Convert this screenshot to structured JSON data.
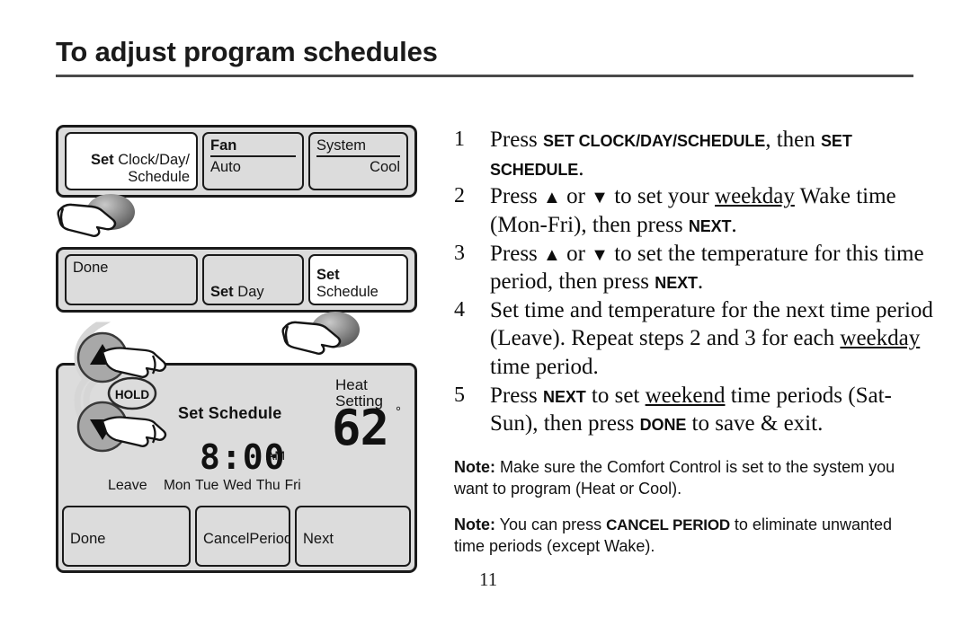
{
  "page": {
    "title": "To adjust program schedules",
    "number": "11"
  },
  "thermostat": {
    "panel1": {
      "buttons": [
        {
          "name": "set-clock-day-schedule",
          "bold_prefix": "Set",
          "line1": " Clock/Day/",
          "line2": "Schedule",
          "highlighted": true
        },
        {
          "name": "fan",
          "header": "Fan",
          "value": "Auto"
        },
        {
          "name": "system",
          "header": "System",
          "value": "Cool"
        }
      ]
    },
    "panel2": {
      "buttons": [
        {
          "name": "done",
          "label": "Done"
        },
        {
          "name": "set-day",
          "bold_prefix": "Set",
          "rest": " Day"
        },
        {
          "name": "set-schedule",
          "bold_prefix": "Set",
          "rest": " Schedule",
          "highlighted": true
        }
      ]
    },
    "display": {
      "mode_label": "Set Schedule",
      "time": "8:00",
      "meridiem": "AM",
      "period_label": "Leave",
      "days": [
        "Mon",
        "Tue",
        "Wed",
        "Thu",
        "Fri"
      ],
      "setting_label_line1": "Heat",
      "setting_label_line2": "Setting",
      "temperature": "62",
      "degree": "°",
      "hold_label": "HOLD"
    },
    "panel3_buttons": [
      {
        "name": "done",
        "label": "Done"
      },
      {
        "name": "cancel-period",
        "label": "CancelPeriod"
      },
      {
        "name": "next",
        "label": "Next"
      }
    ]
  },
  "instructions": {
    "steps": [
      {
        "num": "1",
        "parts": [
          {
            "t": "text",
            "v": "Press "
          },
          {
            "t": "kbd",
            "v": "Set Clock/Day/Schedule"
          },
          {
            "t": "text",
            "v": ", then "
          },
          {
            "t": "kbd",
            "v": "Set Schedule"
          },
          {
            "t": "text",
            "v": "."
          }
        ]
      },
      {
        "num": "2",
        "parts": [
          {
            "t": "text",
            "v": "Press "
          },
          {
            "t": "up",
            "v": "▲"
          },
          {
            "t": "text",
            "v": " or "
          },
          {
            "t": "down",
            "v": "▼"
          },
          {
            "t": "text",
            "v": " to set your "
          },
          {
            "t": "uline",
            "v": "weekday"
          },
          {
            "t": "text",
            "v": " Wake time (Mon-Fri), then press "
          },
          {
            "t": "kbd",
            "v": "Next"
          },
          {
            "t": "text",
            "v": "."
          }
        ]
      },
      {
        "num": "3",
        "parts": [
          {
            "t": "text",
            "v": "Press "
          },
          {
            "t": "up",
            "v": "▲"
          },
          {
            "t": "text",
            "v": " or "
          },
          {
            "t": "down",
            "v": "▼"
          },
          {
            "t": "text",
            "v": " to set the temperature for this time period, then press "
          },
          {
            "t": "kbd",
            "v": "Next"
          },
          {
            "t": "text",
            "v": "."
          }
        ]
      },
      {
        "num": "4",
        "parts": [
          {
            "t": "text",
            "v": "Set time and temperature for the next time period (Leave). Repeat steps 2 and 3 for each "
          },
          {
            "t": "uline",
            "v": "weekday"
          },
          {
            "t": "text",
            "v": " time period."
          }
        ]
      },
      {
        "num": "5",
        "parts": [
          {
            "t": "text",
            "v": "Press "
          },
          {
            "t": "kbd",
            "v": "Next"
          },
          {
            "t": "text",
            "v": " to set "
          },
          {
            "t": "uline",
            "v": "weekend"
          },
          {
            "t": "text",
            "v": " time periods (Sat-Sun), then press "
          },
          {
            "t": "kbd",
            "v": "Done"
          },
          {
            "t": "text",
            "v": " to save & exit."
          }
        ]
      }
    ],
    "notes": [
      {
        "label": "Note:",
        "parts": [
          {
            "t": "text",
            "v": " Make sure the Comfort Control is set to the system you want to program (Heat or Cool)."
          }
        ]
      },
      {
        "label": "Note:",
        "parts": [
          {
            "t": "text",
            "v": " You can press "
          },
          {
            "t": "kbd2",
            "v": "CANCEL PERIOD"
          },
          {
            "t": "text",
            "v": " to eliminate unwanted time periods (except Wake)."
          }
        ]
      }
    ]
  },
  "colors": {
    "panel_bg": "#dcdcdc",
    "panel_border": "#1a1a1a",
    "button_highlight": "#ffffff",
    "text": "#111111",
    "rule": "#4a4a4a"
  }
}
